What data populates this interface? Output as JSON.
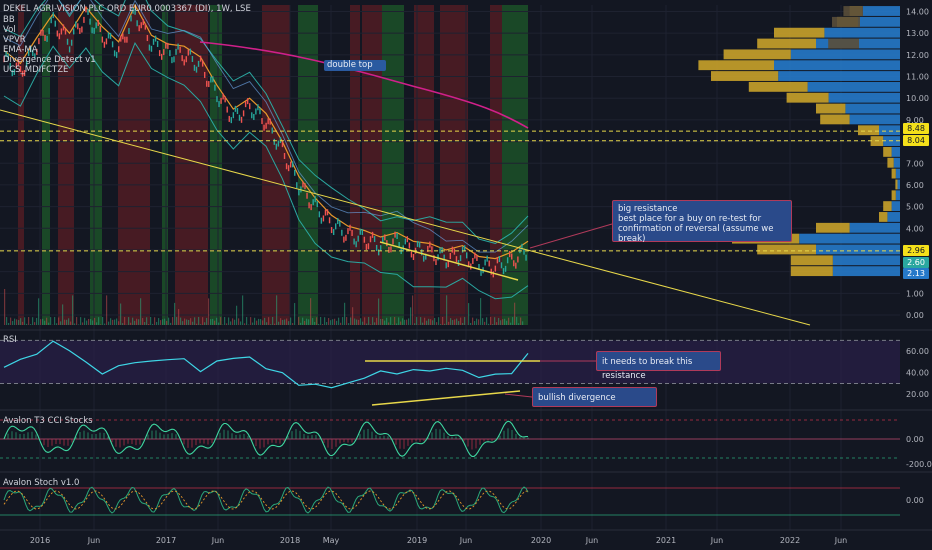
{
  "header": {
    "symbol": "DEKEL AGRI-VISION PLC ORD EUR0.0003367 (DI), 1W, LSE",
    "indicators": [
      "BB",
      "Vol",
      "VPVR",
      "EMA-MA",
      "Divergence Detect v1",
      "UCS_MDIFCTZE"
    ]
  },
  "panes": {
    "rsi_title": "RSI",
    "cci_title": "Avalon T3 CCI Stocks",
    "stoch_title": "Avalon Stoch v1.0"
  },
  "annotations": {
    "double_top": "double top",
    "big_resistance": "big resistance\nbest place for a buy on re-test for confirmation of reversal (assume we break)",
    "rsi_resistance": "it needs to break this resistance",
    "bullish_divergence": "bullish divergence"
  },
  "price_tags": {
    "tag1": "8.48",
    "tag2": "8.04",
    "tag3": "2.96",
    "tag4": "2.60",
    "tag5": "2.13"
  },
  "colors": {
    "background": "#131722",
    "bullish_bg": "#1e5a2a",
    "bearish_bg": "#5a1e24",
    "trendline": "#e8d84a",
    "bb_band": "#2aa7a0",
    "ema_orange": "#e8982a",
    "ma_magenta": "#d0208a",
    "rsi_line": "#3ed6e6",
    "vpvr_blue": "#2679c9",
    "vpvr_gold": "#c9a22a",
    "note_blue": "#2a4a8a",
    "note_border": "#b03a5a"
  },
  "chart_data": [
    {
      "type": "line",
      "title": "DEKEL AGRI-VISION PLC ORD EUR0.0003367 (DI), 1W, LSE",
      "x_ticks": [
        "2016",
        "Jun",
        "2017",
        "Jun",
        "2018",
        "May",
        "2019",
        "Jun",
        "2020",
        "Jun",
        "2021",
        "Jun",
        "2022",
        "Jun"
      ],
      "y_ticks": [
        "14.00",
        "13.00",
        "12.00",
        "11.00",
        "10.00",
        "9.00",
        "8.00",
        "7.00",
        "6.00",
        "5.00",
        "4.00",
        "3.00",
        "2.00",
        "1.00",
        "0.00"
      ],
      "ylim": [
        0,
        14.3
      ],
      "series": [
        {
          "values": [
            11.8,
            11.2,
            12.4,
            13.5,
            12.6,
            13.8,
            12.9,
            12.2,
            13.9,
            12.5,
            12.1,
            12.0,
            11.5,
            10.2,
            9.1,
            9.6,
            8.9,
            7.6,
            6.0,
            5.0,
            4.2,
            3.7,
            3.5,
            3.2,
            3.4,
            3.0,
            2.9,
            2.6,
            2.8,
            2.3,
            2.2,
            2.5,
            3.0
          ]
        }
      ],
      "horizontal_levels": [
        8.48,
        8.04,
        2.96
      ],
      "volume_profile": [
        {
          "price": 14.0,
          "buy": 0.9,
          "sell": 0.3
        },
        {
          "price": 13.5,
          "buy": 1.0,
          "sell": 0.5
        },
        {
          "price": 13.0,
          "buy": 1.8,
          "sell": 1.2
        },
        {
          "price": 12.5,
          "buy": 2.0,
          "sell": 1.4
        },
        {
          "price": 12.0,
          "buy": 2.6,
          "sell": 1.6
        },
        {
          "price": 11.5,
          "buy": 3.0,
          "sell": 1.8
        },
        {
          "price": 11.0,
          "buy": 2.9,
          "sell": 1.6
        },
        {
          "price": 10.5,
          "buy": 2.2,
          "sell": 1.4
        },
        {
          "price": 10.0,
          "buy": 1.7,
          "sell": 1.0
        },
        {
          "price": 9.5,
          "buy": 1.3,
          "sell": 0.7
        },
        {
          "price": 9.0,
          "buy": 1.2,
          "sell": 0.7
        },
        {
          "price": 8.5,
          "buy": 0.5,
          "sell": 0.5
        },
        {
          "price": 8.0,
          "buy": 0.4,
          "sell": 0.3
        },
        {
          "price": 7.5,
          "buy": 0.2,
          "sell": 0.2
        },
        {
          "price": 7.0,
          "buy": 0.15,
          "sell": 0.15
        },
        {
          "price": 6.5,
          "buy": 0.1,
          "sell": 0.1
        },
        {
          "price": 6.0,
          "buy": 0.06,
          "sell": 0.05
        },
        {
          "price": 5.5,
          "buy": 0.1,
          "sell": 0.1
        },
        {
          "price": 5.0,
          "buy": 0.2,
          "sell": 0.2
        },
        {
          "price": 4.5,
          "buy": 0.3,
          "sell": 0.2
        },
        {
          "price": 4.0,
          "buy": 1.2,
          "sell": 0.8
        },
        {
          "price": 3.5,
          "buy": 2.4,
          "sell": 1.6
        },
        {
          "price": 3.0,
          "buy": 2.0,
          "sell": 1.4
        },
        {
          "price": 2.5,
          "buy": 1.6,
          "sell": 1.0
        },
        {
          "price": 2.0,
          "buy": 1.6,
          "sell": 1.0
        }
      ]
    },
    {
      "type": "line",
      "title": "RSI",
      "y_ticks": [
        "60.00",
        "40.00",
        "20.00"
      ],
      "ylim": [
        10,
        75
      ],
      "series": [
        {
          "values": [
            45,
            52,
            58,
            68,
            62,
            48,
            41,
            44,
            52,
            48,
            55,
            50,
            44,
            48,
            56,
            52,
            46,
            38,
            30,
            28,
            27,
            30,
            35,
            42,
            38,
            44,
            40,
            46,
            40,
            38,
            36,
            42,
            55
          ]
        }
      ]
    },
    {
      "type": "line",
      "title": "Avalon T3 CCI Stocks",
      "y_ticks": [
        "0.00",
        "-200.00"
      ]
    },
    {
      "type": "line",
      "title": "Avalon Stoch v1.0",
      "y_ticks": [
        "0.00"
      ]
    }
  ]
}
